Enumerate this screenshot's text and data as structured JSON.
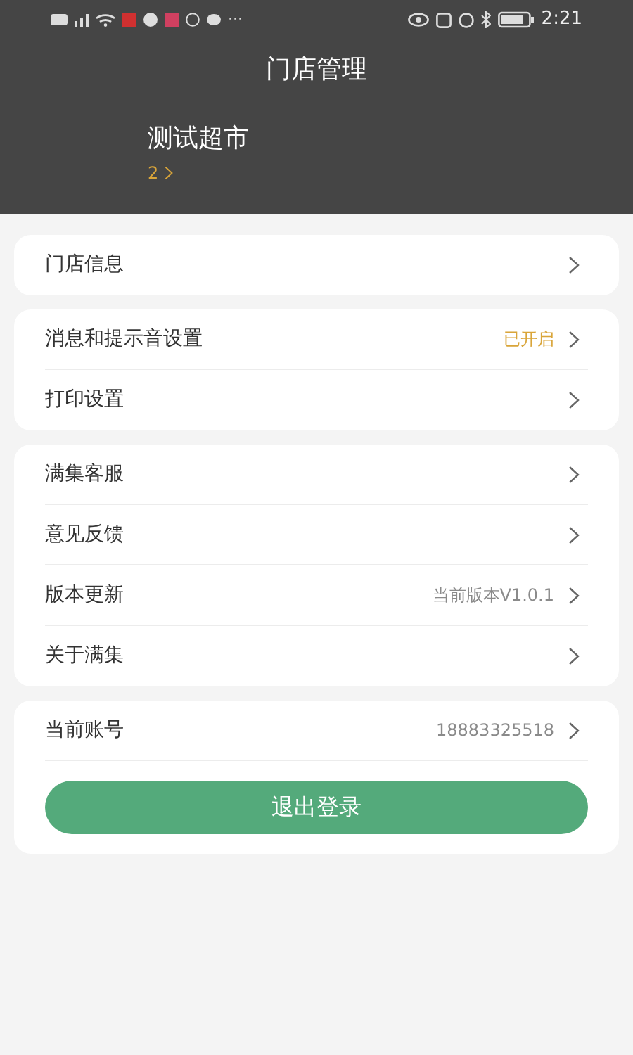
{
  "status_bar": {
    "overflow": "···",
    "time": "2:21"
  },
  "header": {
    "title": "门店管理",
    "store_name": "测试超市",
    "store_count": "2"
  },
  "groups": [
    {
      "rows": [
        {
          "label": "门店信息"
        }
      ]
    },
    {
      "rows": [
        {
          "label": "消息和提示音设置",
          "value": {
            "text": "已开启",
            "kind": "status"
          }
        },
        {
          "label": "打印设置"
        }
      ]
    },
    {
      "rows": [
        {
          "label": "满集客服"
        },
        {
          "label": "意见反馈"
        },
        {
          "label": "版本更新",
          "value": {
            "text": "当前版本V1.0.1",
            "kind": "info"
          }
        },
        {
          "label": "关于满集"
        }
      ]
    },
    {
      "rows": [
        {
          "label": "当前账号",
          "value": {
            "text": "18883325518",
            "kind": "info"
          }
        }
      ],
      "button": "退出登录"
    }
  ]
}
